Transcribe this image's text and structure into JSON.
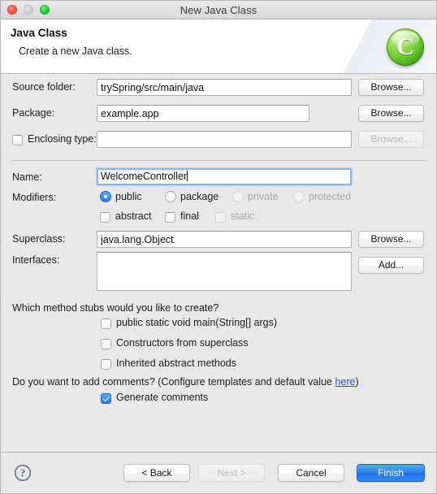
{
  "window": {
    "title": "New Java Class",
    "traffic_lights": [
      "close-button",
      "minimize-button",
      "maximize-button"
    ]
  },
  "banner": {
    "title": "Java Class",
    "subtitle": "Create a new Java class.",
    "icon": "java-class-icon",
    "icon_letter": "C"
  },
  "form": {
    "source_folder": {
      "label": "Source folder:",
      "value": "trySpring/src/main/java",
      "button": "Browse..."
    },
    "package": {
      "label": "Package:",
      "value": "example.app",
      "button": "Browse..."
    },
    "enclosing_type": {
      "label": "Enclosing type:",
      "value": "",
      "checked": false,
      "button": "Browse...",
      "button_disabled": true
    },
    "name": {
      "label": "Name:",
      "value": "WelcomeController",
      "focused": true
    },
    "modifiers": {
      "label": "Modifiers:",
      "radios": [
        {
          "label": "public",
          "selected": true,
          "disabled": false
        },
        {
          "label": "package",
          "selected": false,
          "disabled": false
        },
        {
          "label": "private",
          "selected": false,
          "disabled": true
        },
        {
          "label": "protected",
          "selected": false,
          "disabled": true
        }
      ],
      "checkboxes": [
        {
          "label": "abstract",
          "checked": false,
          "disabled": false
        },
        {
          "label": "final",
          "checked": false,
          "disabled": false
        },
        {
          "label": "static",
          "checked": false,
          "disabled": true
        }
      ]
    },
    "superclass": {
      "label": "Superclass:",
      "value": "java.lang.Object",
      "button": "Browse..."
    },
    "interfaces": {
      "label": "Interfaces:",
      "value": "",
      "button": "Add..."
    }
  },
  "stubs": {
    "question": "Which method stubs would you like to create?",
    "options": [
      {
        "label": "public static void main(String[] args)",
        "checked": false
      },
      {
        "label": "Constructors from superclass",
        "checked": false
      },
      {
        "label": "Inherited abstract methods",
        "checked": false
      }
    ]
  },
  "comments": {
    "question_prefix": "Do you want to add comments? (Configure templates and default value ",
    "link": "here",
    "question_suffix": ")",
    "option": {
      "label": "Generate comments",
      "checked": true
    }
  },
  "footer": {
    "help": "help-icon",
    "back": "< Back",
    "next": "Next >",
    "next_disabled": true,
    "cancel": "Cancel",
    "finish": "Finish"
  },
  "colors": {
    "accent": "#2a7bec",
    "link": "#2953d8",
    "icon_green": "#63c32a",
    "background": "#e8e8e8"
  }
}
